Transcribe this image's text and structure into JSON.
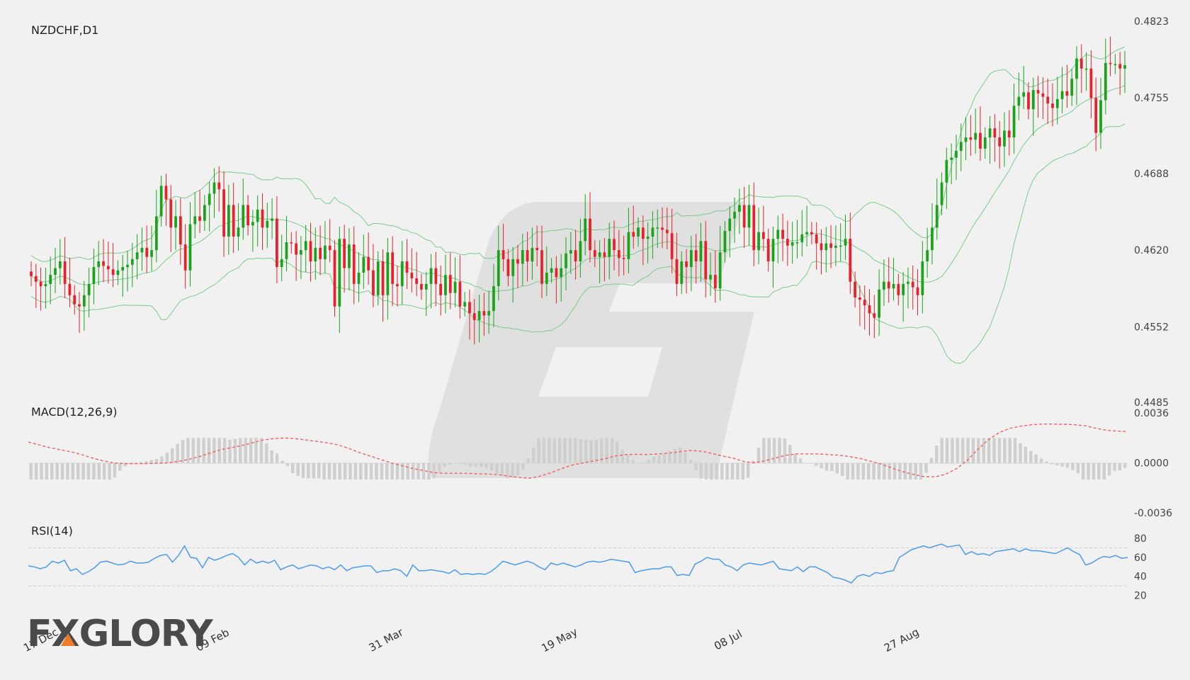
{
  "brand": {
    "name": "FXGLORY",
    "accent": "#f07a2a"
  },
  "colors": {
    "up": "#1aa31a",
    "down": "#e8202a",
    "band": "#7ccb8c",
    "signal": "#f06060",
    "rsi": "#4c9bf0",
    "hist": "#cfcfcf"
  },
  "chart_data": [
    {
      "type": "candlestick",
      "title": "NZDCHF,D1",
      "ylim": [
        0.4485,
        0.4823
      ],
      "yticks": [
        "0.4823",
        "0.4755",
        "0.4688",
        "0.4620",
        "0.4552",
        "0.4485"
      ],
      "xticks": [
        {
          "label": "17 Dec",
          "index": 0
        },
        {
          "label": "09 Feb",
          "index": 38
        },
        {
          "label": "31 Mar",
          "index": 74
        },
        {
          "label": "19 May",
          "index": 110
        },
        {
          "label": "08 Jul",
          "index": 145
        },
        {
          "label": "27 Aug",
          "index": 181
        }
      ],
      "closes": [
        0.4597,
        0.4592,
        0.4588,
        0.459,
        0.4598,
        0.4604,
        0.461,
        0.459,
        0.458,
        0.4572,
        0.457,
        0.458,
        0.459,
        0.4605,
        0.461,
        0.4606,
        0.4603,
        0.4598,
        0.4602,
        0.4605,
        0.4607,
        0.4612,
        0.4618,
        0.4622,
        0.4614,
        0.462,
        0.465,
        0.4677,
        0.4665,
        0.464,
        0.465,
        0.4625,
        0.4602,
        0.4643,
        0.465,
        0.4646,
        0.466,
        0.467,
        0.468,
        0.4674,
        0.4632,
        0.466,
        0.4632,
        0.464,
        0.466,
        0.4642,
        0.4645,
        0.4656,
        0.464,
        0.4646,
        0.4648,
        0.4605,
        0.4612,
        0.4627,
        0.4626,
        0.4616,
        0.462,
        0.4628,
        0.461,
        0.4622,
        0.4612,
        0.4624,
        0.462,
        0.457,
        0.463,
        0.4604,
        0.4625,
        0.459,
        0.46,
        0.4614,
        0.4602,
        0.458,
        0.461,
        0.458,
        0.4618,
        0.459,
        0.4588,
        0.461,
        0.46,
        0.4595,
        0.459,
        0.4585,
        0.459,
        0.4604,
        0.459,
        0.458,
        0.4598,
        0.4582,
        0.4592,
        0.457,
        0.4574,
        0.4564,
        0.4558,
        0.4566,
        0.4562,
        0.4566,
        0.4588,
        0.462,
        0.4612,
        0.4597,
        0.4612,
        0.4608,
        0.462,
        0.461,
        0.4622,
        0.462,
        0.459,
        0.46,
        0.4604,
        0.4596,
        0.4604,
        0.4617,
        0.462,
        0.461,
        0.4628,
        0.4648,
        0.462,
        0.4614,
        0.4618,
        0.4614,
        0.463,
        0.462,
        0.4613,
        0.4612,
        0.4636,
        0.4632,
        0.464,
        0.463,
        0.4632,
        0.464,
        0.464,
        0.4638,
        0.4635,
        0.4612,
        0.459,
        0.461,
        0.4605,
        0.462,
        0.461,
        0.4628,
        0.4594,
        0.4598,
        0.4586,
        0.4618,
        0.4637,
        0.4648,
        0.4654,
        0.466,
        0.464,
        0.466,
        0.462,
        0.4636,
        0.463,
        0.461,
        0.463,
        0.4638,
        0.463,
        0.4624,
        0.4627,
        0.4627,
        0.4634,
        0.4636,
        0.4634,
        0.4626,
        0.462,
        0.4626,
        0.4622,
        0.4624,
        0.4624,
        0.463,
        0.4592,
        0.4578,
        0.4576,
        0.4571,
        0.4564,
        0.456,
        0.4585,
        0.4592,
        0.4586,
        0.459,
        0.458,
        0.459,
        0.4592,
        0.4587,
        0.458,
        0.461,
        0.462,
        0.464,
        0.466,
        0.468,
        0.47,
        0.4702,
        0.4708,
        0.4716,
        0.472,
        0.4718,
        0.4724,
        0.471,
        0.472,
        0.4728,
        0.472,
        0.4712,
        0.4726,
        0.472,
        0.4748,
        0.4756,
        0.476,
        0.4745,
        0.4762,
        0.4759,
        0.4756,
        0.475,
        0.4746,
        0.4754,
        0.4761,
        0.4757,
        0.4772,
        0.479,
        0.4781,
        0.4781,
        0.4755,
        0.4724,
        0.4753,
        0.4786,
        0.4785,
        0.4785,
        0.4781,
        0.4784
      ]
    },
    {
      "type": "macd",
      "title": "MACD(12,26,9)",
      "ylim": [
        -0.0036,
        0.0036
      ],
      "yticks": [
        "0.0036",
        "0.0000",
        "-0.0036"
      ],
      "signal": [
        0.0015,
        0.0013,
        0.0011,
        0.00095,
        0.0008,
        0.0006,
        0.00035,
        0.00015,
        0.0,
        -5e-05,
        -5e-05,
        -5e-05,
        -3e-05,
        0.0,
        0.0001,
        0.00025,
        0.00045,
        0.0007,
        0.00095,
        0.0011,
        0.00125,
        0.00145,
        0.00165,
        0.00175,
        0.0018,
        0.00175,
        0.00165,
        0.00155,
        0.00145,
        0.0013,
        0.00105,
        0.00075,
        0.0005,
        0.00025,
        0.0,
        -0.0002,
        -0.0004,
        -0.00055,
        -0.0007,
        -0.00075,
        -0.00075,
        -0.00075,
        -0.00078,
        -0.0008,
        -0.00085,
        -0.00095,
        -0.00105,
        -0.0011,
        -0.00095,
        -0.0007,
        -0.0004,
        -0.00015,
        0.0,
        0.00015,
        0.0003,
        0.0005,
        0.0006,
        0.00062,
        0.0006,
        0.00065,
        0.0007,
        0.0008,
        0.0009,
        0.00085,
        0.0007,
        0.0005,
        0.00035,
        0.0001,
        0.0,
        0.00015,
        0.00035,
        0.00055,
        0.00065,
        0.00065,
        0.00065,
        0.0006,
        0.00055,
        0.00045,
        0.0003,
        0.0001,
        -0.0001,
        -0.0004,
        -0.00065,
        -0.00085,
        -0.001,
        -0.001,
        -0.0008,
        -0.0004,
        0.0002,
        0.001,
        0.0017,
        0.0022,
        0.0025,
        0.00265,
        0.00275,
        0.0028,
        0.0028,
        0.00278,
        0.00275,
        0.00268,
        0.0025,
        0.00235,
        0.0023,
        0.00225
      ]
    },
    {
      "type": "line",
      "title": "RSI(14)",
      "ylim": [
        10,
        80
      ],
      "yticks": [
        "80",
        "60",
        "40",
        "20"
      ],
      "levels": [
        70,
        30
      ],
      "values": [
        51,
        50,
        48,
        50,
        56,
        54,
        57,
        46,
        48,
        42,
        45,
        49,
        55,
        56,
        54,
        52,
        53,
        56,
        54,
        54,
        55,
        59,
        62,
        63,
        55,
        62,
        72,
        60,
        59,
        49,
        60,
        57,
        59,
        62,
        64,
        60,
        52,
        58,
        54,
        56,
        54,
        57,
        47,
        50,
        52,
        48,
        50,
        52,
        51,
        48,
        50,
        47,
        52,
        46,
        49,
        50,
        51,
        51,
        44,
        46,
        46,
        48,
        46,
        40,
        52,
        46,
        46,
        47,
        46,
        45,
        43,
        47,
        42,
        43,
        42,
        43,
        42,
        45,
        50,
        56,
        54,
        52,
        54,
        56,
        54,
        50,
        47,
        54,
        52,
        54,
        52,
        50,
        52,
        55,
        56,
        55,
        56,
        58,
        57,
        56,
        55,
        44,
        46,
        47,
        48,
        48,
        50,
        50,
        41,
        42,
        41,
        53,
        56,
        60,
        58,
        58,
        52,
        50,
        46,
        52,
        54,
        53,
        52,
        54,
        56,
        48,
        47,
        46,
        50,
        45,
        50,
        50,
        47,
        44,
        39,
        38,
        36,
        33,
        40,
        42,
        40,
        44,
        43,
        45,
        46,
        60,
        64,
        68,
        70,
        72,
        70,
        72,
        74,
        71,
        72,
        73,
        63,
        66,
        63,
        64,
        62,
        66,
        67,
        68,
        69,
        66,
        69,
        67,
        67,
        66,
        65,
        64,
        67,
        70,
        66,
        63,
        52,
        54,
        58,
        61,
        60,
        62,
        59,
        60
      ]
    }
  ]
}
